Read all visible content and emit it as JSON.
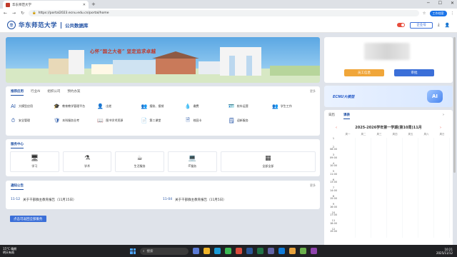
{
  "browser": {
    "tab_title": "华东师范大学",
    "url": "https://portal2023.ecnu.edu.cn/portal/home",
    "profile": "工作档案"
  },
  "header": {
    "school": "华东师范大学",
    "portal": "公共数据库",
    "header_button": "企业号"
  },
  "banner": {
    "slogan": "心怀“国之大者”  坚定追求卓越"
  },
  "user_card": {
    "btn_left": "员工信息",
    "btn_right": "审批"
  },
  "ai_card": {
    "title": "ECNU大模型",
    "badge": "AI"
  },
  "apps": {
    "tabs": [
      "推荐应用",
      "行业AI",
      "组织公司",
      "预约办案"
    ],
    "more": "更多",
    "items": [
      {
        "icon": "ai-icon",
        "glyph": "AI",
        "label": "大模型应用"
      },
      {
        "icon": "cap-icon",
        "glyph": "🎓",
        "label": "教育教学管理平台"
      },
      {
        "icon": "person-icon",
        "glyph": "👤",
        "label": "出差"
      },
      {
        "icon": "finance-icon",
        "glyph": "👥",
        "label": "报账、报销"
      },
      {
        "icon": "drop-icon",
        "glyph": "💧",
        "label": "缴费"
      },
      {
        "icon": "id-card-icon",
        "glyph": "🪪",
        "label": "校车运营"
      },
      {
        "icon": "student-icon",
        "glyph": "👥",
        "label": "学生工作"
      },
      {
        "icon": "clock-icon",
        "glyph": "⏱",
        "label": "安全管理"
      },
      {
        "icon": "safety-icon",
        "glyph": "🛡",
        "label": "本科服务业考"
      },
      {
        "icon": "book-icon",
        "glyph": "📖",
        "label": "图书学术资源"
      },
      {
        "icon": "paper-icon",
        "glyph": "📄",
        "label": "第二课堂"
      },
      {
        "icon": "form-icon",
        "glyph": "🗎",
        "label": "校园卡"
      },
      {
        "icon": "note-icon",
        "glyph": "🗒",
        "label": "迎新服务"
      }
    ]
  },
  "services": {
    "title": "服务中心",
    "items": [
      {
        "icon": "monitor-icon",
        "glyph": "🖥",
        "label": "学习"
      },
      {
        "icon": "flask-icon",
        "glyph": "⚗",
        "label": "学术"
      },
      {
        "icon": "cup-icon",
        "glyph": "☕",
        "label": "生活服务"
      },
      {
        "icon": "computer-icon",
        "glyph": "💻",
        "label": "IT服务"
      },
      {
        "icon": "grid-icon",
        "glyph": "▦",
        "label": "全部全部"
      }
    ]
  },
  "news": {
    "title": "通知公告",
    "more": "更多",
    "items": [
      {
        "date": "11-12",
        "title": "关于干部群主教育报告（11月15日）"
      },
      {
        "date": "11-04",
        "title": "关于干部群主教育报告（11月5日）"
      }
    ]
  },
  "feedback_button": "点击可返回全部服务",
  "calendar": {
    "tabs": [
      "日历",
      "课表"
    ],
    "active_tab": 1,
    "title": "2025-2026学年第一学期(第10周)11月",
    "days": [
      "",
      "周一",
      "周二",
      "周三",
      "周四",
      "周五",
      "周六",
      "周日"
    ],
    "slots": [
      {
        "n": "1",
        "t": ""
      },
      {
        "n": "2",
        "t": "08:00"
      },
      {
        "n": "3",
        "t": "09:00"
      },
      {
        "n": "4",
        "t": "10:00"
      },
      {
        "n": "5",
        "t": "11:00"
      },
      {
        "n": "6",
        "t": "13:00"
      },
      {
        "n": "7",
        "t": "14:00"
      },
      {
        "n": "8",
        "t": "15:00"
      },
      {
        "n": "9",
        "t": "16:00"
      },
      {
        "n": "10",
        "t": "17:00"
      },
      {
        "n": "11",
        "t": "18:00"
      },
      {
        "n": "12",
        "t": "19:00"
      }
    ]
  },
  "taskbar": {
    "weather": "15°C 晴朗",
    "weather_sub": "明天有雨",
    "search": "搜索",
    "time": "10:21",
    "date": "2025/11/12"
  }
}
